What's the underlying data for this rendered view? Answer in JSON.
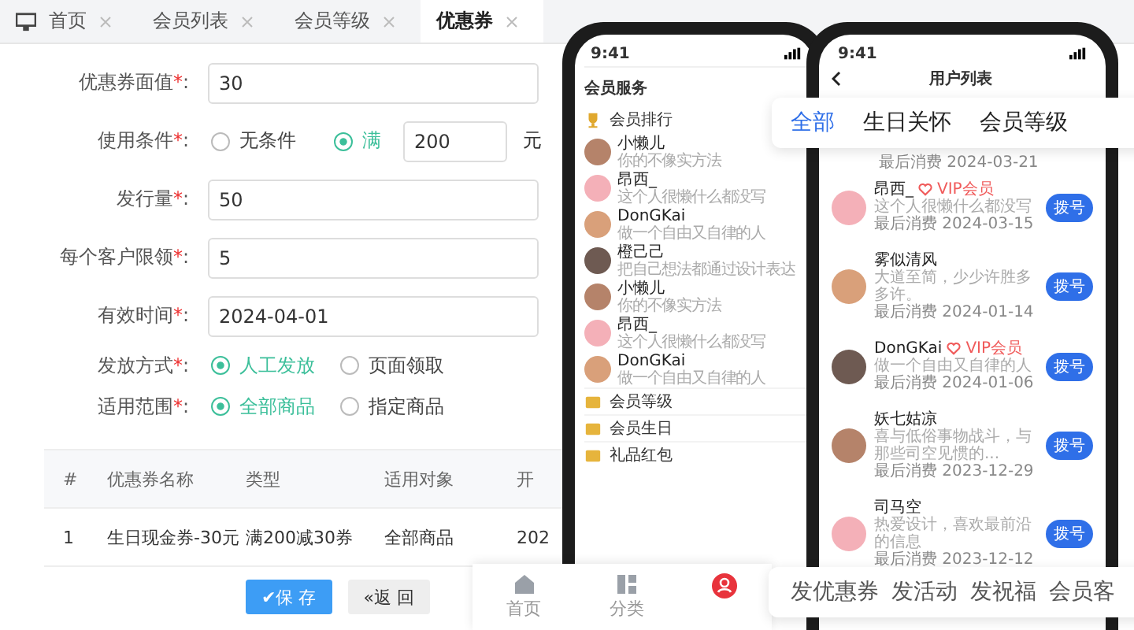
{
  "tabs": [
    {
      "label": "首页",
      "selected": false,
      "home": true
    },
    {
      "label": "会员列表",
      "selected": false,
      "home": false
    },
    {
      "label": "会员等级",
      "selected": false,
      "home": false
    },
    {
      "label": "优惠券",
      "selected": true,
      "home": false
    }
  ],
  "form": {
    "face_value": {
      "label": "优惠券面值",
      "star": "*",
      "colon": ":",
      "value": "30"
    },
    "condition": {
      "label": "使用条件",
      "star": "*",
      "colon": ":",
      "options": [
        {
          "label": "无条件",
          "selected": false
        },
        {
          "label": "满",
          "selected": true
        }
      ],
      "amount": "200",
      "unit": "元"
    },
    "quantity": {
      "label": "发行量",
      "star": "*",
      "colon": ":",
      "value": "50"
    },
    "limit": {
      "label": "每个客户限领",
      "star": "*",
      "colon": ":",
      "value": "5"
    },
    "valid_time": {
      "label": "有效时间",
      "star": "*",
      "colon": ":",
      "value": "2024-04-01"
    },
    "issue_method": {
      "label": "发放方式",
      "star": "*",
      "colon": ":",
      "options": [
        {
          "label": "人工发放",
          "selected": true
        },
        {
          "label": "页面领取",
          "selected": false
        }
      ]
    },
    "scope": {
      "label": "适用范围",
      "star": "*",
      "colon": ":",
      "options": [
        {
          "label": "全部商品",
          "selected": true
        },
        {
          "label": "指定商品",
          "selected": false
        }
      ]
    }
  },
  "table": {
    "columns": [
      "#",
      "优惠券名称",
      "类型",
      "适用对象",
      "开"
    ],
    "rows": [
      [
        "1",
        "生日现金券-30元",
        "满200减30券",
        "全部商品",
        "202"
      ]
    ]
  },
  "buttons": {
    "save": "✔保 存",
    "back": "«返 回"
  },
  "phone_1": {
    "time": "9:41",
    "title": "会员服务",
    "ranking": "会员排行",
    "members": [
      {
        "name": "小懒儿",
        "bio": "你的不像实方法"
      },
      {
        "name": "昂西_",
        "bio": "这个人很懒什么都没写"
      },
      {
        "name": "DonGKai",
        "bio": "做一个自由又自律的人"
      },
      {
        "name": "橙己己",
        "bio": "把自己想法都通过设计表达"
      },
      {
        "name": "小懒儿",
        "bio": "你的不像实方法"
      },
      {
        "name": "昂西_",
        "bio": "这个人很懒什么都没写"
      },
      {
        "name": "DonGKai",
        "bio": "做一个自由又自律的人"
      }
    ],
    "menu": [
      "会员等级",
      "会员生日",
      "礼品红包"
    ],
    "nav": [
      "首页",
      "分类"
    ]
  },
  "phone_2": {
    "time": "9:41",
    "title": "用户列表",
    "first_date": "最后消费 2024-03-21",
    "users": [
      {
        "name": "昂西_",
        "vip": true,
        "badge": "VIP会员",
        "bio": "这个人很懒什么都没写",
        "last": "最后消费 2024-03-15",
        "call": "拨号"
      },
      {
        "name": "雾似清风",
        "vip": false,
        "bio": "大道至简，少少许胜多多许。",
        "last": "最后消费 2024-01-14",
        "call": "拨号"
      },
      {
        "name": "DonGKai",
        "vip": true,
        "badge": "VIP会员",
        "bio": "做一个自由又自律的人",
        "last": "最后消费 2024-01-06",
        "call": "拨号"
      },
      {
        "name": "妖七姑凉",
        "vip": false,
        "bio": "喜与低俗事物战斗，与那些司空见惯的...",
        "last": "最后消费 2023-12-29",
        "call": "拨号"
      },
      {
        "name": "司马空",
        "vip": false,
        "bio": "热爱设计，喜欢最前沿的信息",
        "last": "最后消费 2023-12-12",
        "call": "拨号"
      }
    ]
  },
  "filter_tabs": [
    {
      "label": "全部",
      "selected": true
    },
    {
      "label": "生日关怀",
      "selected": false
    },
    {
      "label": "会员等级",
      "selected": false
    }
  ],
  "actions": [
    "发优惠券",
    "发活动",
    "发祝福",
    "会员客"
  ]
}
